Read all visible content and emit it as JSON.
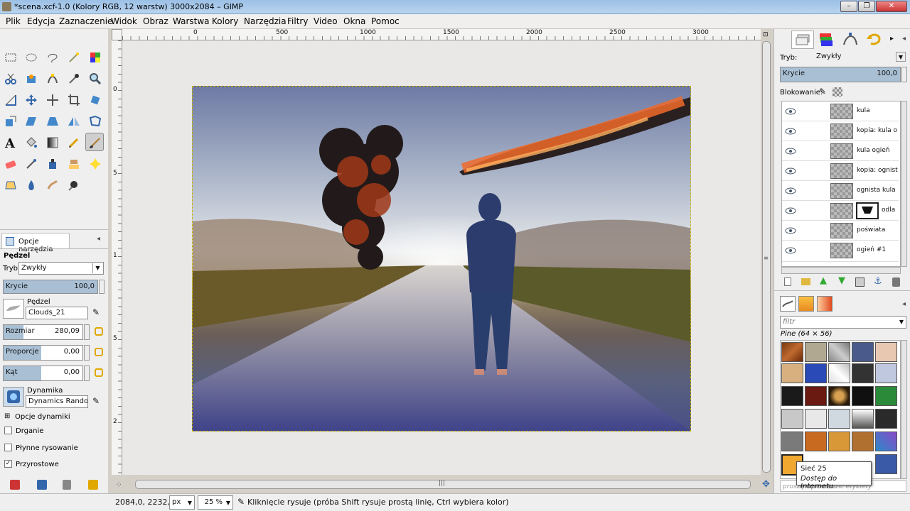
{
  "window": {
    "title": "*scena.xcf-1.0 (Kolory RGB, 12 warstw) 3000x2084 – GIMP"
  },
  "menu": [
    {
      "label": "Plik"
    },
    {
      "label": "Edycja"
    },
    {
      "label": "Zaznaczenie"
    },
    {
      "label": "Widok"
    },
    {
      "label": "Obraz"
    },
    {
      "label": "Warstwa"
    },
    {
      "label": "Kolory"
    },
    {
      "label": "Narzędzia"
    },
    {
      "label": "Filtry"
    },
    {
      "label": "Video"
    },
    {
      "label": "Okna"
    },
    {
      "label": "Pomoc"
    }
  ],
  "ruler": {
    "h_ticks": [
      "0",
      "500",
      "1000",
      "1500",
      "2000",
      "2500",
      "3000"
    ],
    "v_ticks": [
      "0",
      "5",
      "1",
      "5",
      "2",
      "2"
    ]
  },
  "colors": {
    "foreground": "#f06030",
    "background": "#ffffff"
  },
  "tool_options": {
    "tab_label": "Opcje narzędzia",
    "section_title": "Pędzel",
    "mode_label": "Tryb:",
    "mode_value": "Zwykły",
    "opacity_label": "Krycie",
    "opacity_value": "100,0",
    "brush_label": "Pędzel",
    "brush_value": "Clouds_21",
    "size_label": "Rozmiar",
    "size_value": "280,09",
    "ratio_label": "Proporcje",
    "ratio_value": "0,00",
    "angle_label": "Kąt",
    "angle_value": "0,00",
    "dynamics_label": "Dynamika",
    "dynamics_value": "Dynamics Random",
    "dynamics_options": "Opcje dynamiki",
    "jitter": "Drganie",
    "smooth": "Płynne rysowanie",
    "incremental": "Przyrostowe"
  },
  "layers_panel": {
    "mode_label": "Tryb:",
    "mode_value": "Zwykły",
    "opacity_label": "Krycie",
    "opacity_value": "100,0",
    "lock_label": "Blokowanie:",
    "layers": [
      {
        "name": "kula"
      },
      {
        "name": "kopia: kula o"
      },
      {
        "name": "kula ogień"
      },
      {
        "name": "kopia: ognist"
      },
      {
        "name": "ognista kula"
      },
      {
        "name": "odla"
      },
      {
        "name": "poświata"
      },
      {
        "name": "ogień #1"
      }
    ]
  },
  "patterns_panel": {
    "filter_placeholder": "filtr",
    "current_pattern": "Pine (64 × 56)",
    "tag_placeholder": "proszę wprowadzić etykiety",
    "tooltip_title": "Sieć 25",
    "tooltip_sub": "Dostęp do Internetu"
  },
  "status": {
    "coords": "2084,0, 2232,0",
    "unit": "px",
    "zoom": "25 %",
    "hint": "Kliknięcie rysuje (próba Shift rysuje prostą linię, Ctrl wybiera kolor)"
  }
}
